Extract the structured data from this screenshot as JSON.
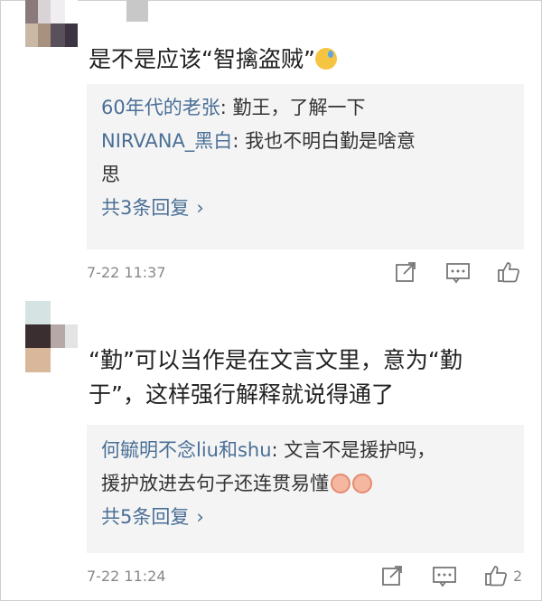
{
  "comments": [
    {
      "text": "是不是应该“智擒盗贼”",
      "replies": [
        {
          "name": "60年代的老张",
          "text": ": 勤王，了解一下"
        },
        {
          "name": "NIRVANA_黑白",
          "text": ": 我也不明白勤是啥意",
          "text2": "思"
        }
      ],
      "more": "共3条回复",
      "time": "7-22 11:37",
      "likes": ""
    },
    {
      "line1": "“勤”可以当作是在文言文里，意为“勤",
      "line2": "于”，这样强行解释就说得通了",
      "replies": [
        {
          "name": "何毓明不念liu和shu",
          "text": ": 文言不是援护吗，",
          "text2": "援护放进去句子还连贯易懂"
        }
      ],
      "more": "共5条回复",
      "time": "7-22 11:24",
      "likes": "2"
    }
  ],
  "icons": {
    "share": "share-icon",
    "comment": "comment-icon",
    "like": "thumbs-up-icon",
    "chevron": "›",
    "emoji": "cold-sweat-emoji",
    "peach": "peach-emoji"
  },
  "colors": {
    "link": "#4a6f96",
    "reply_bg": "#f4f4f4",
    "meta": "#888888"
  }
}
